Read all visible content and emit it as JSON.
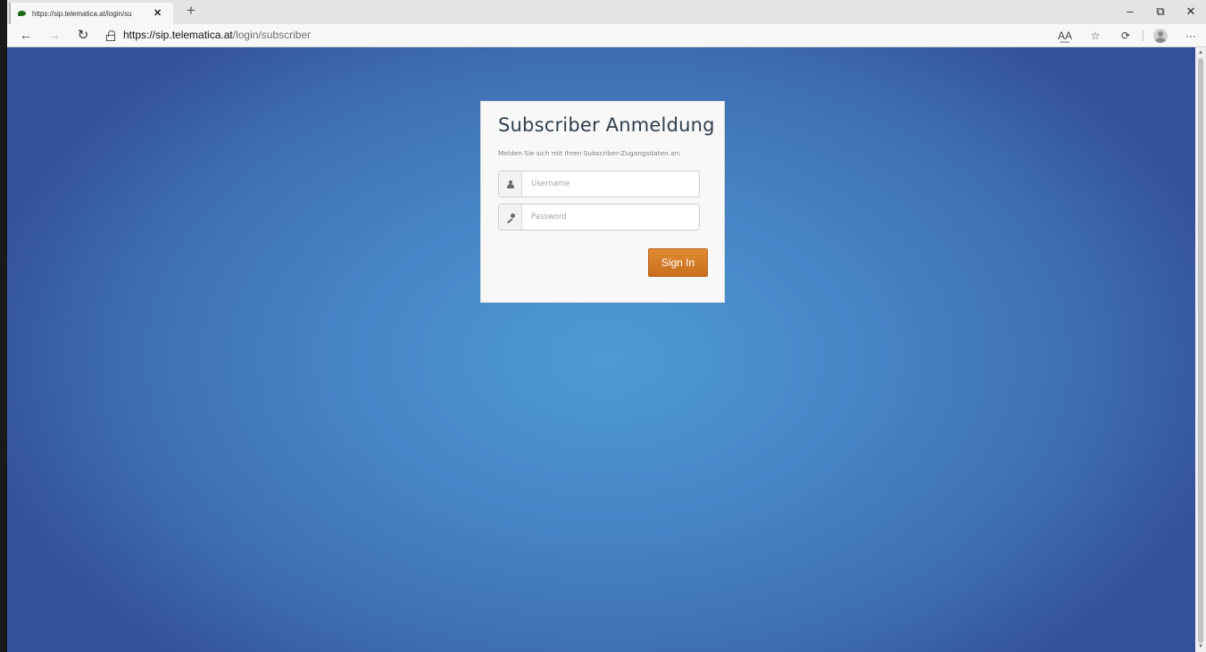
{
  "browser": {
    "tab": {
      "title": "https://sip.telematica.at/login/su",
      "close_glyph": "✕"
    },
    "new_tab_glyph": "+",
    "window_controls": {
      "minimize": "–",
      "restore": "⧉",
      "close": "✕"
    },
    "nav": {
      "back": "←",
      "forward": "→",
      "reload": "↻"
    },
    "url": {
      "host": "https://sip.telematica.at",
      "path": "/login/subscriber"
    },
    "toolbar": {
      "read_aloud": "A͟A",
      "favorite": "☆",
      "sync": "⟳",
      "more": "···"
    }
  },
  "login": {
    "title": "Subscriber Anmeldung",
    "subtitle": "Melden Sie sich mit Ihren Subscriber-Zugangsdaten an:",
    "username": {
      "placeholder": "Username",
      "value": "",
      "icon": "user-icon"
    },
    "password": {
      "placeholder": "Password",
      "value": "",
      "icon": "key-icon"
    },
    "submit_label": "Sign In"
  },
  "colors": {
    "background_center": "#4d9ad6",
    "background_edge": "#34509a",
    "button": "#d77e26",
    "title": "#2f3e4e"
  }
}
